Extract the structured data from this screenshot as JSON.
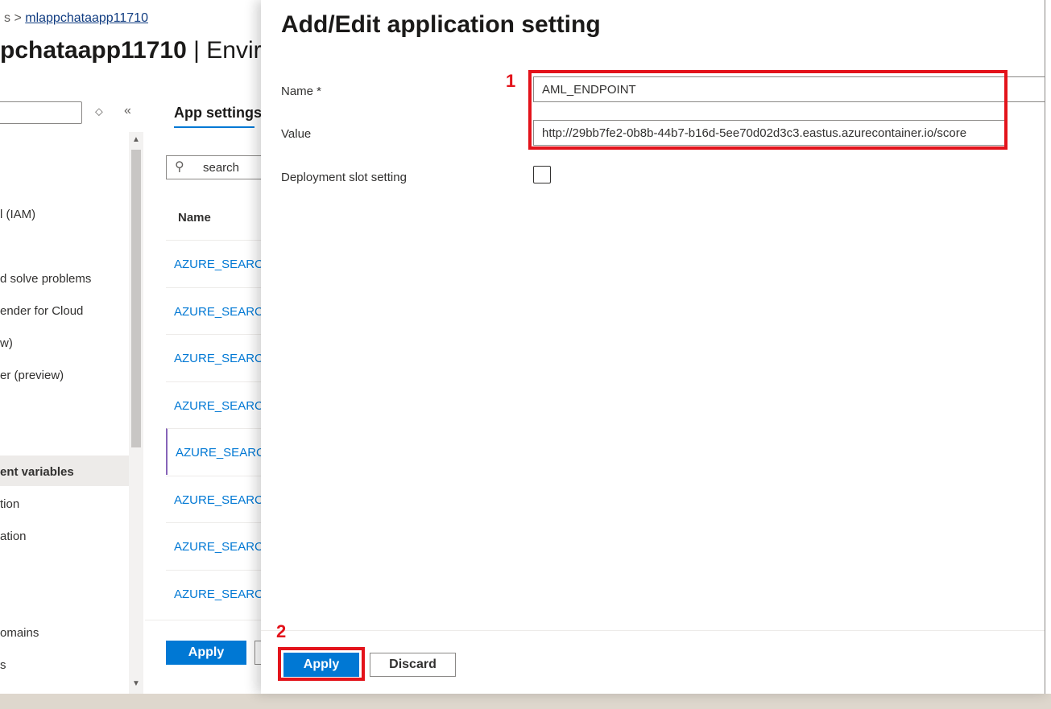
{
  "breadcrumb": {
    "prefix": "s >",
    "link": "mlappchataapp11710"
  },
  "page_title": {
    "name": "pchataapp11710",
    "separator": " | ",
    "section": "Environ"
  },
  "sidebar": {
    "items": [
      {
        "label": "l (IAM)"
      },
      {
        "label": "d solve problems"
      },
      {
        "label": "ender for Cloud"
      },
      {
        "label": "w)"
      },
      {
        "label": "er (preview)"
      },
      {
        "label": "ent variables"
      },
      {
        "label": "tion"
      },
      {
        "label": "ation"
      },
      {
        "label": "omains"
      },
      {
        "label": "s"
      }
    ]
  },
  "main": {
    "tab": "App settings",
    "search_text": "search",
    "column_name": "Name",
    "rows": [
      "AZURE_SEARCH",
      "AZURE_SEARCH",
      "AZURE_SEARCH",
      "AZURE_SEARCH",
      "AZURE_SEARCH",
      "AZURE_SEARCH",
      "AZURE_SEARCH",
      "AZURE_SEARCH"
    ],
    "apply_label": "Apply"
  },
  "panel": {
    "title": "Add/Edit application setting",
    "name_label": "Name *",
    "name_value": "AML_ENDPOINT",
    "value_label": "Value",
    "value_value": "http://29bb7fe2-0b8b-44b7-b16d-5ee70d02d3c3.eastus.azurecontainer.io/score",
    "slot_label": "Deployment slot setting",
    "slot_checked": false,
    "apply_label": "Apply",
    "discard_label": "Discard"
  },
  "annotations": {
    "step1": "1",
    "step2": "2"
  },
  "colors": {
    "accent": "#0078d4",
    "highlight": "#e3131b",
    "link": "#0078d4"
  }
}
